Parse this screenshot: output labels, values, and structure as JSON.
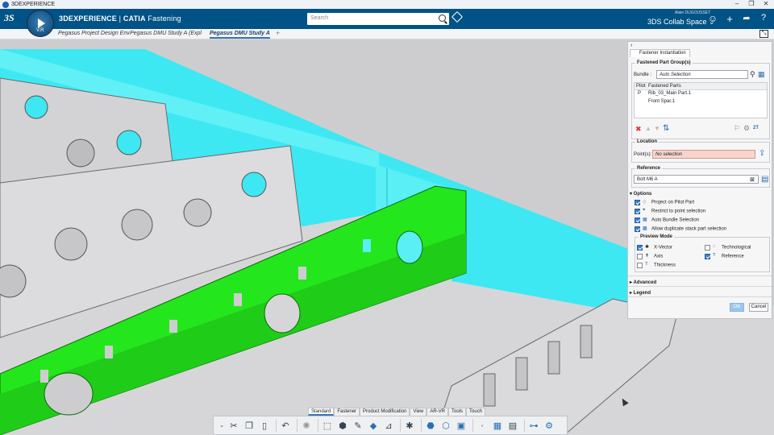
{
  "window": {
    "title": "3DEXPERIENCE",
    "controls": [
      "–",
      "❐",
      "✕"
    ]
  },
  "header": {
    "brand_bold": "3DEXPERIENCE",
    "brand_separator": " | ",
    "brand_app": "CATIA",
    "brand_module": " Fastening",
    "compass_version": "V.R",
    "search_placeholder": "Search",
    "user_name": "Alain DUGOUSSET",
    "collab_space": "3DS Collab Space ⌄",
    "icons": [
      "user-icon",
      "plus-icon",
      "share-icon",
      "help-icon"
    ]
  },
  "tabs": [
    {
      "label": "Pegasus Project Design Env",
      "active": false
    },
    {
      "label": "Pegasus DMU Study A (Expl",
      "active": false
    },
    {
      "label": "Pegasus DMU Study A",
      "active": true
    }
  ],
  "panel": {
    "title": "Fastener Instantiation",
    "fastened_group_label": "Fastened Part Group(s)",
    "bundle_label": "Bundle :",
    "bundle_value": "Auto Selection",
    "col_pilot": "Pilot",
    "col_parts": "Fastened Parts",
    "parts": [
      {
        "pilot": "P",
        "name": "Rib_03_Main Part.1"
      },
      {
        "pilot": "",
        "name": "Front Spar.1"
      }
    ],
    "count_label": "2T",
    "location_label": "Location",
    "points_label": "Point(s):",
    "points_value": "No selection",
    "reference_label": "Reference",
    "reference_value": "Bolt M6 A",
    "options_label": "▾ Options",
    "options": [
      {
        "label": "Project on Pilot Part",
        "checked": true
      },
      {
        "label": "Restrict to point selection",
        "checked": true
      },
      {
        "label": "Auto Bundle Selection",
        "checked": true
      },
      {
        "label": "Allow duplicate stack part selection",
        "checked": true
      }
    ],
    "preview_mode_label": "Preview Mode",
    "preview": [
      {
        "label": "X-Vector",
        "checked": true
      },
      {
        "label": "Technological",
        "checked": false
      },
      {
        "label": "Axis",
        "checked": false
      },
      {
        "label": "Reference",
        "checked": true
      },
      {
        "label": "Thickness",
        "checked": false
      }
    ],
    "advanced_label": "▸ Advanced",
    "legend_label": "▸ Legend",
    "ok_label": "OK",
    "cancel_label": "Cancel"
  },
  "toolbar_tabs": [
    {
      "label": "Standard",
      "active": true
    },
    {
      "label": "Fastener",
      "active": false
    },
    {
      "label": "Product Modification",
      "active": false
    },
    {
      "label": "View",
      "active": false
    },
    {
      "label": "AR-VR",
      "active": false
    },
    {
      "label": "Tools",
      "active": false
    },
    {
      "label": "Touch",
      "active": false
    }
  ],
  "toolbar_icons": [
    "cut-icon",
    "copy-icon",
    "paste-icon",
    "undo-icon",
    "update-icon",
    "fastener-icon",
    "assembly-icon",
    "pen-icon",
    "part-icon",
    "measure-icon",
    "axis-icon",
    "grid-icon",
    "table-icon",
    "tree-icon",
    "settings-icon"
  ],
  "colors": {
    "header": "#005386",
    "cyan_skin": "#3de8f2",
    "green_rib": "#24e61c",
    "ok_button": "#9cc6ea"
  }
}
